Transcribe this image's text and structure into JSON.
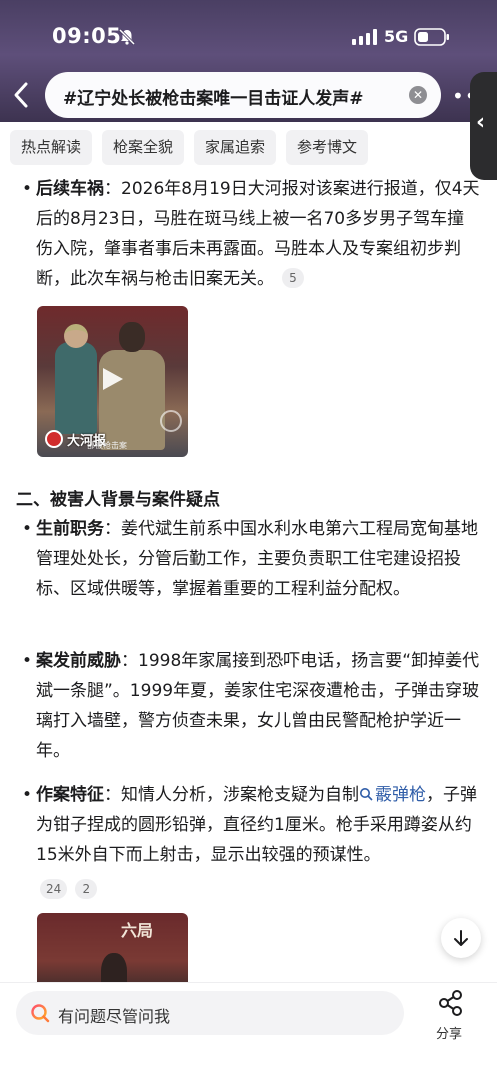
{
  "status_bar": {
    "time": "09:05",
    "network": "5G"
  },
  "search": {
    "query": "#辽宁处长被枪击案唯一目击证人发声#"
  },
  "tabs": [
    "热点解读",
    "枪案全貌",
    "家属追索",
    "参考博文"
  ],
  "content": {
    "aftermath": {
      "label": "后续车祸",
      "text": "：2026年8月19日大河报对该案进行报道，仅4天后的8月23日，马胜在斑马线上被一名70多岁男子驾车撞伤入院，肇事者事后未再露面。马胜本人及专案组初步判断，此次车祸与枪击旧案无关。",
      "cite": "5"
    },
    "video_thumb": {
      "watermark": "大河报",
      "caption": "部被枪击案"
    },
    "section_title": "二、被害人背景与案件疑点",
    "background": {
      "label": "生前职务",
      "text": "：姜代斌生前系中国水利水电第六工程局宽甸基地管理处处长，分管后勤工作，主要负责职工住宅建设招投标、区域供暖等，掌握着重要的工程利益分配权。"
    },
    "threats": {
      "label": "案发前威胁",
      "text": "：1998年家属接到恐吓电话，扬言要“卸掉姜代斌一条腿”。1999年夏，姜家住宅深夜遭枪击，子弹击穿玻璃打入墙壁，警方侦查未果，女儿曾由民警配枪护学近一年。"
    },
    "features": {
      "label": "作案特征",
      "text_before": "：知情人分析，涉案枪支疑为自制",
      "link": "霰弹枪",
      "text_after": "，子弹为钳子捏成的圆形铅弹，直径约1厘米。枪手采用蹲姿从约15米外自下而上射击，显示出较强的预谋性。",
      "cites": [
        "24",
        "2"
      ]
    },
    "second_thumb": {
      "sign": "六局"
    }
  },
  "bottom": {
    "ask_placeholder": "有问题尽管问我",
    "share_label": "分享"
  },
  "colors": {
    "header": "#4a3f63",
    "link": "#2f5da8",
    "tab_bg": "#f1f1f3"
  }
}
